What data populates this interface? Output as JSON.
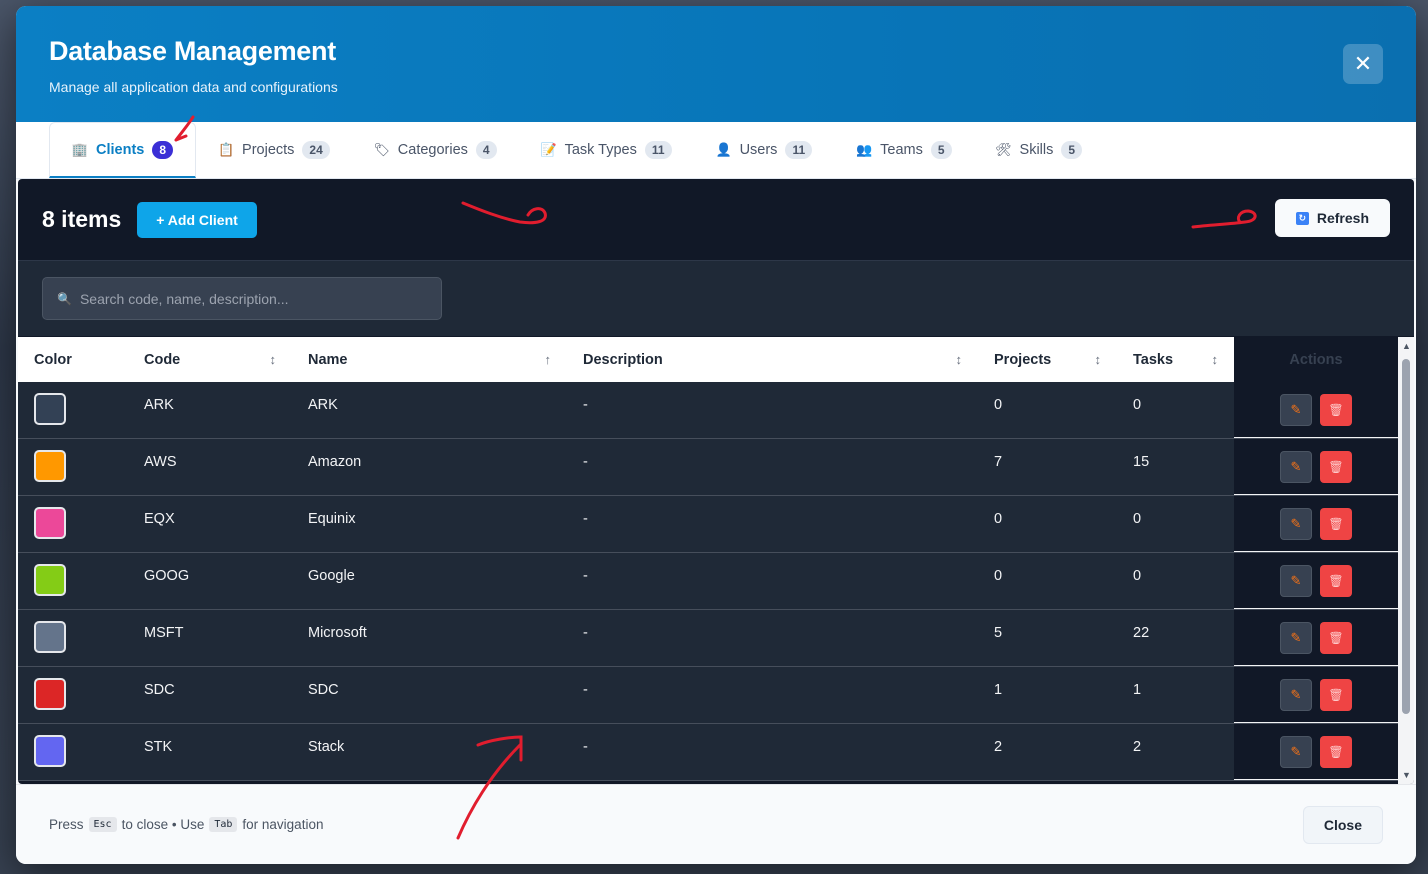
{
  "modal": {
    "title": "Database Management",
    "subtitle": "Manage all application data and configurations",
    "close_icon": "✕"
  },
  "tabs": [
    {
      "label": "Clients",
      "count": "8",
      "icon": "building-icon",
      "glyph": "🏢",
      "active": true
    },
    {
      "label": "Projects",
      "count": "24",
      "icon": "clipboard-icon",
      "glyph": "📋"
    },
    {
      "label": "Categories",
      "count": "4",
      "icon": "tag-icon",
      "glyph": "🏷"
    },
    {
      "label": "Task Types",
      "count": "11",
      "icon": "memo-icon",
      "glyph": "📝"
    },
    {
      "label": "Users",
      "count": "11",
      "icon": "user-icon",
      "glyph": "👤"
    },
    {
      "label": "Teams",
      "count": "5",
      "icon": "team-icon",
      "glyph": "👥"
    },
    {
      "label": "Skills",
      "count": "5",
      "icon": "tools-icon",
      "glyph": "🛠"
    }
  ],
  "toolbar": {
    "count_label": "8 items",
    "add_label": "+ Add Client",
    "refresh_label": "Refresh"
  },
  "search": {
    "placeholder": "Search code, name, description..."
  },
  "table": {
    "headers": {
      "color": "Color",
      "code": "Code",
      "name": "Name",
      "description": "Description",
      "projects": "Projects",
      "tasks": "Tasks",
      "actions": "Actions"
    },
    "sort_icons": {
      "code": "↕",
      "name": "↑",
      "description": "↕",
      "projects": "↕",
      "tasks": "↕"
    },
    "rows": [
      {
        "color": "#334155",
        "code": "ARK",
        "name": "ARK",
        "description": "-",
        "projects": "0",
        "tasks": "0"
      },
      {
        "color": "#ff9800",
        "code": "AWS",
        "name": "Amazon",
        "description": "-",
        "projects": "7",
        "tasks": "15"
      },
      {
        "color": "#ec4899",
        "code": "EQX",
        "name": "Equinix",
        "description": "-",
        "projects": "0",
        "tasks": "0"
      },
      {
        "color": "#84cc16",
        "code": "GOOG",
        "name": "Google",
        "description": "-",
        "projects": "0",
        "tasks": "0"
      },
      {
        "color": "#64748b",
        "code": "MSFT",
        "name": "Microsoft",
        "description": "-",
        "projects": "5",
        "tasks": "22"
      },
      {
        "color": "#dc2626",
        "code": "SDC",
        "name": "SDC",
        "description": "-",
        "projects": "1",
        "tasks": "1"
      },
      {
        "color": "#6366f1",
        "code": "STK",
        "name": "Stack",
        "description": "-",
        "projects": "2",
        "tasks": "2"
      }
    ]
  },
  "footer": {
    "press": "Press",
    "esc_key": "Esc",
    "to_close": "to close • Use",
    "tab_key": "Tab",
    "for_nav": "for navigation",
    "close_label": "Close"
  },
  "colors": {
    "accent": "#0b7fc4",
    "add_button": "#0ea5e9",
    "delete_button": "#ef4444",
    "annotation": "#e11d2e"
  }
}
